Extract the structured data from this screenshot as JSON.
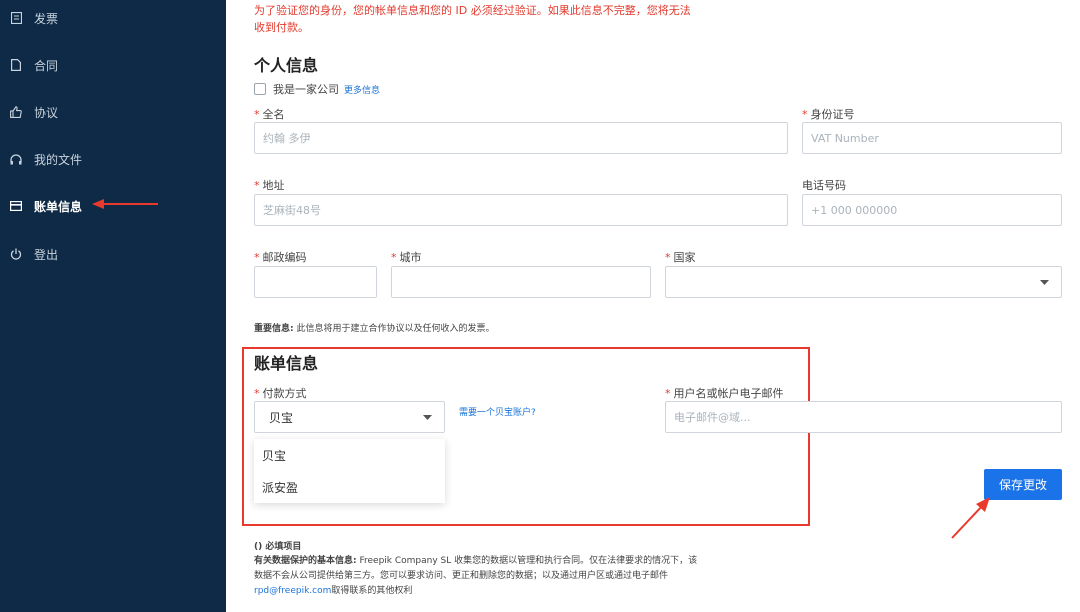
{
  "sidebar": {
    "items": [
      {
        "label": "发票",
        "icon": "invoice-icon"
      },
      {
        "label": "合同",
        "icon": "document-icon"
      },
      {
        "label": "协议",
        "icon": "thumbs-up-icon"
      },
      {
        "label": "我的文件",
        "icon": "headset-icon"
      },
      {
        "label": "账单信息",
        "icon": "card-icon"
      },
      {
        "label": "登出",
        "icon": "power-icon"
      }
    ]
  },
  "notice": {
    "line1": "为了验证您的身份，您的帐单信息和您的 ID 必须经过验证。如果此信息不完整，您将无法",
    "line2": "收到付款。"
  },
  "personal": {
    "title": "个人信息",
    "company_checkbox": "我是一家公司",
    "more_info": "更多信息",
    "full_name_label": "全名",
    "full_name_placeholder": "约翰 多伊",
    "id_label": "身份证号",
    "id_placeholder": "VAT Number",
    "address_label": "地址",
    "address_placeholder": "芝麻街48号",
    "phone_label": "电话号码",
    "phone_placeholder": "+1 000 000000",
    "zip_label": "邮政编码",
    "city_label": "城市",
    "country_label": "国家",
    "important_label": "重要信息:",
    "important_text": "此信息将用于建立合作协议以及任何收入的发票。"
  },
  "billing": {
    "title": "账单信息",
    "payment_label": "付款方式",
    "payment_value": "贝宝",
    "options": [
      "贝宝",
      "派安盈"
    ],
    "need_account": "需要一个贝宝账户?",
    "email_label": "用户名或帐户电子邮件",
    "email_placeholder": "电子邮件@域...",
    "save_button": "保存更改"
  },
  "footer": {
    "required": "()  必填项目",
    "privacy_title": "有关数据保护的基本信息:",
    "privacy_line1": "Freepik Company SL 收集您的数据以管理和执行合同。仅在法律要求的情况下，该",
    "privacy_line2": "数据不会从公司提供给第三方。您可以要求访问、更正和删除您的数据；以及通过用户区或通过电子邮件",
    "email_link": "rpd@freepik.com",
    "privacy_line3": "取得联系的其他权利"
  },
  "colors": {
    "sidebar": "#0e2a47",
    "accent": "#1a73e8",
    "annotation": "#e8392c"
  }
}
